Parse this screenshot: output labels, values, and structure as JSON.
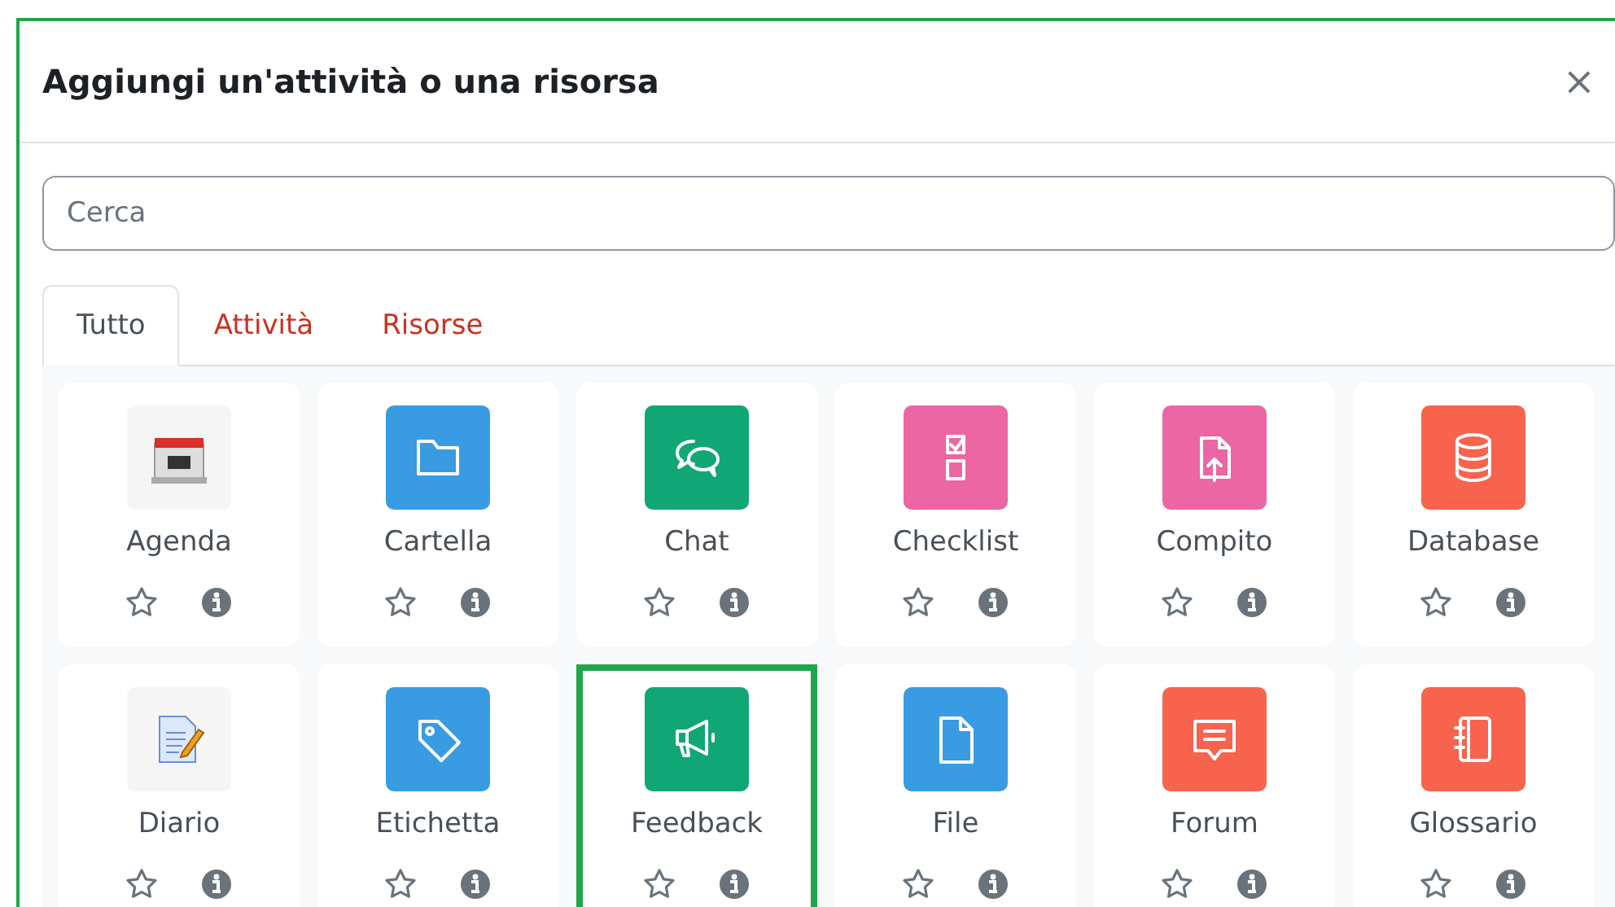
{
  "dialog": {
    "title": "Aggiungi un'attività o una risorsa",
    "close": "×"
  },
  "search": {
    "placeholder": "Cerca"
  },
  "tabs": [
    {
      "label": "Tutto",
      "selected": true
    },
    {
      "label": "Attività",
      "selected": false
    },
    {
      "label": "Risorse",
      "selected": false
    }
  ],
  "items": [
    {
      "label": "Agenda",
      "color": "#f5f5f5",
      "highlighted": false
    },
    {
      "label": "Cartella",
      "color": "#399be2",
      "highlighted": false
    },
    {
      "label": "Chat",
      "color": "#11a676",
      "highlighted": false
    },
    {
      "label": "Checklist",
      "color": "#eb66a2",
      "highlighted": false
    },
    {
      "label": "Compito",
      "color": "#eb66a2",
      "highlighted": false
    },
    {
      "label": "Database",
      "color": "#f7634d",
      "highlighted": false
    },
    {
      "label": "Diario",
      "color": "#f5f5f5",
      "highlighted": false
    },
    {
      "label": "Etichetta",
      "color": "#399be2",
      "highlighted": false
    },
    {
      "label": "Feedback",
      "color": "#11a676",
      "highlighted": true
    },
    {
      "label": "File",
      "color": "#399be2",
      "highlighted": false
    },
    {
      "label": "Forum",
      "color": "#f7634d",
      "highlighted": false
    },
    {
      "label": "Glossario",
      "color": "#f7634d",
      "highlighted": false
    }
  ]
}
